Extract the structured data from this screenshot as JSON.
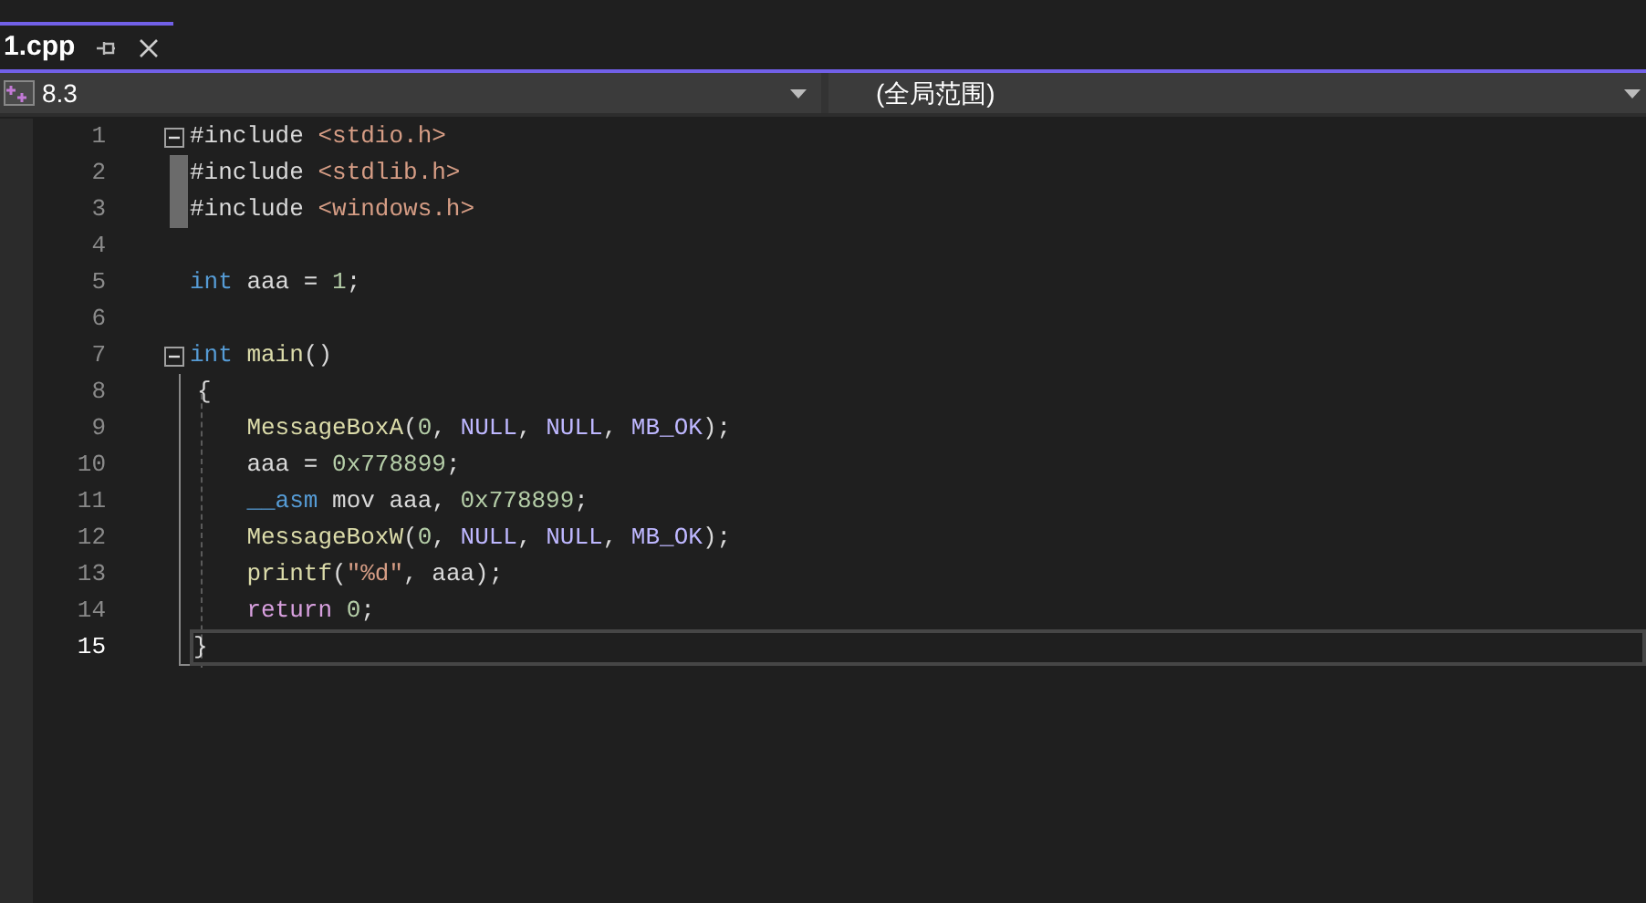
{
  "tab": {
    "title": "1.cpp",
    "selected": true
  },
  "nav": {
    "project": "8.3",
    "scope": "(全局范围)"
  },
  "lines": [
    {
      "number": "1",
      "kind": "top",
      "current": false,
      "fold": {
        "expanded": true
      },
      "tokens": [
        {
          "kind": "plain",
          "text": "#include "
        },
        {
          "kind": "string",
          "text": "<stdio.h>"
        }
      ]
    },
    {
      "number": "2",
      "kind": "top",
      "current": false,
      "tokens": [
        {
          "kind": "plain",
          "text": "#include "
        },
        {
          "kind": "string",
          "text": "<stdlib.h>"
        }
      ]
    },
    {
      "number": "3",
      "kind": "top",
      "current": false,
      "tokens": [
        {
          "kind": "plain",
          "text": "#include "
        },
        {
          "kind": "string",
          "text": "<windows.h>"
        }
      ]
    },
    {
      "number": "4",
      "current": false
    },
    {
      "number": "5",
      "kind": "top",
      "current": false,
      "tokens": [
        {
          "kind": "keyword",
          "text": "int"
        },
        {
          "kind": "plain",
          "text": " aaa = "
        },
        {
          "kind": "number",
          "text": "1"
        },
        {
          "kind": "plain",
          "text": ";"
        }
      ]
    },
    {
      "number": "6",
      "current": false
    },
    {
      "number": "7",
      "kind": "top",
      "current": false,
      "fold": {
        "expanded": true
      },
      "tokens": [
        {
          "kind": "keyword",
          "text": "int"
        },
        {
          "kind": "function",
          "text": "main",
          "spaced": true
        },
        {
          "kind": "plain",
          "text": "()"
        }
      ]
    },
    {
      "number": "8",
      "kind": "brace",
      "current": false,
      "tokens": [
        {
          "kind": "plain",
          "text": "{"
        }
      ]
    },
    {
      "number": "9",
      "kind": "body",
      "current": false,
      "tokens": [
        {
          "kind": "function",
          "text": "MessageBoxA"
        },
        {
          "kind": "plain",
          "text": "("
        },
        {
          "kind": "number",
          "text": "0"
        },
        {
          "kind": "plain",
          "text": ", "
        },
        {
          "kind": "macro",
          "text": "NULL"
        },
        {
          "kind": "plain",
          "text": ", "
        },
        {
          "kind": "macro",
          "text": "NULL"
        },
        {
          "kind": "plain",
          "text": ", "
        },
        {
          "kind": "macro",
          "text": "MB_OK"
        },
        {
          "kind": "plain",
          "text": ");"
        }
      ]
    },
    {
      "number": "10",
      "kind": "body",
      "current": false,
      "tokens": [
        {
          "kind": "plain",
          "text": "aaa = "
        },
        {
          "kind": "number",
          "text": "0x778899"
        },
        {
          "kind": "plain",
          "text": ";"
        }
      ]
    },
    {
      "number": "11",
      "kind": "body",
      "current": false,
      "tokens": [
        {
          "kind": "keyword",
          "text": "__asm"
        },
        {
          "kind": "plain",
          "text": " mov aaa, "
        },
        {
          "kind": "number",
          "text": "0x778899"
        },
        {
          "kind": "plain",
          "text": ";"
        }
      ]
    },
    {
      "number": "12",
      "kind": "body",
      "current": false,
      "tokens": [
        {
          "kind": "function",
          "text": "MessageBoxW"
        },
        {
          "kind": "plain",
          "text": "("
        },
        {
          "kind": "number",
          "text": "0"
        },
        {
          "kind": "plain",
          "text": ", "
        },
        {
          "kind": "macro",
          "text": "NULL"
        },
        {
          "kind": "plain",
          "text": ", "
        },
        {
          "kind": "macro",
          "text": "NULL"
        },
        {
          "kind": "plain",
          "text": ", "
        },
        {
          "kind": "macro",
          "text": "MB_OK"
        },
        {
          "kind": "plain",
          "text": ");"
        }
      ]
    },
    {
      "number": "13",
      "kind": "body",
      "current": false,
      "tokens": [
        {
          "kind": "function",
          "text": "printf"
        },
        {
          "kind": "plain",
          "text": "("
        },
        {
          "kind": "string",
          "text": "\"%d\""
        },
        {
          "kind": "plain",
          "text": ", aaa);"
        }
      ]
    },
    {
      "number": "14",
      "kind": "body",
      "current": false,
      "tokens": [
        {
          "kind": "control",
          "text": "return"
        },
        {
          "kind": "number",
          "text": "0",
          "spaced": true
        },
        {
          "kind": "plain",
          "text": ";"
        }
      ]
    },
    {
      "number": "15",
      "kind": "top",
      "current": true,
      "tokens": [
        {
          "kind": "plain",
          "text": "}"
        }
      ]
    }
  ]
}
